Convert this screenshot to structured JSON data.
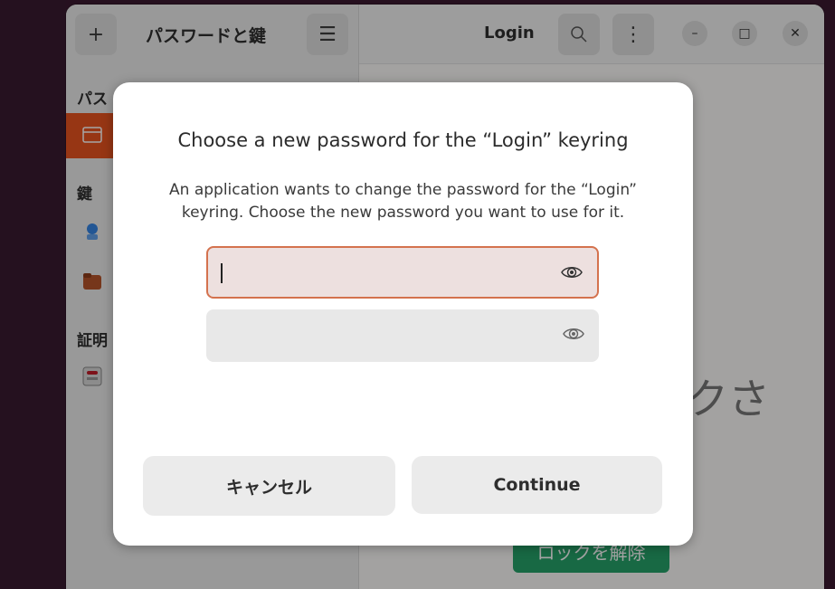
{
  "app": {
    "sidebar_title": "パスワードと鍵",
    "sections": {
      "passwords": "パス",
      "keys": "鍵",
      "certificates": "証明"
    },
    "content_title": "Login",
    "locked_message": "ックさ",
    "unlock_label": "ロックを解除",
    "header_icons": {
      "new": "plus-icon",
      "menu": "hamburger-icon",
      "search": "search-icon",
      "more": "vertical-dots-icon",
      "minimize": "minimize-icon",
      "maximize": "maximize-icon",
      "close": "close-icon"
    },
    "accent_color": "#e95420",
    "unlock_color": "#26a269"
  },
  "dialog": {
    "title": "Choose a new password for the “Login” keyring",
    "message_line1": "An application wants to change the password for the “Login”",
    "message_line2": "keyring. Choose the new password you want to use for it.",
    "password_field": {
      "value": "",
      "placeholder": ""
    },
    "confirm_field": {
      "value": "",
      "placeholder": ""
    },
    "reveal_icon": "eye-icon",
    "cancel_label": "キャンセル",
    "continue_label": "Continue",
    "focus_color": "#d4724e"
  }
}
